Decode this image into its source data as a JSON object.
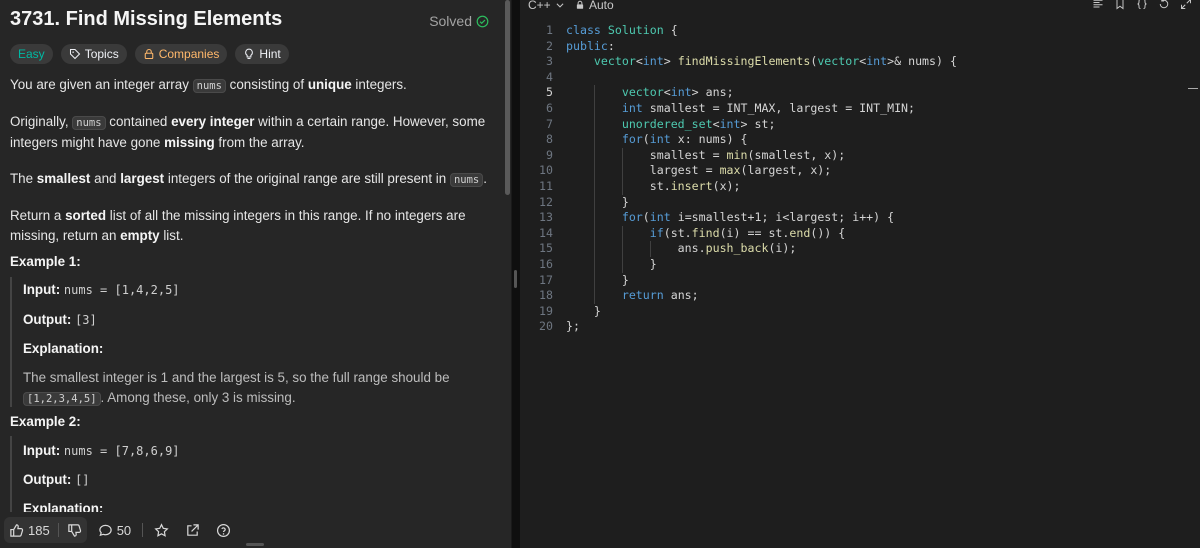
{
  "problem": {
    "title": "3731. Find Missing Elements",
    "solved_label": "Solved",
    "tags": {
      "difficulty": "Easy",
      "topics": "Topics",
      "companies": "Companies",
      "hint": "Hint"
    },
    "description": {
      "p1": [
        "You are given an integer array ",
        "nums",
        " consisting of ",
        "unique",
        " integers."
      ],
      "p2": [
        "Originally, ",
        "nums",
        " contained ",
        "every integer",
        " within a certain range. However, some integers might have gone ",
        "missing",
        " from the array."
      ],
      "p3": [
        "The ",
        "smallest",
        " and ",
        "largest",
        " integers of the original range are still present in ",
        "nums",
        "."
      ],
      "p4": [
        "Return a ",
        "sorted",
        " list of all the missing integers in this range. If no integers are missing, return an ",
        "empty",
        " list."
      ]
    },
    "examples": [
      {
        "title": "Example 1:",
        "input_label": "Input:",
        "input_value": "nums = [1,4,2,5]",
        "output_label": "Output:",
        "output_value": "[3]",
        "explanation_label": "Explanation:",
        "explanation_pre": "The smallest integer is 1 and the largest is 5, so the full range should be ",
        "explanation_code": "[1,2,3,4,5]",
        "explanation_post": ". Among these, only 3 is missing."
      },
      {
        "title": "Example 2:",
        "input_label": "Input:",
        "input_value": "nums = [7,8,6,9]",
        "output_label": "Output:",
        "output_value": "[]",
        "explanation_label": "Explanation:"
      }
    ]
  },
  "bottom_bar": {
    "likes": "185",
    "comments": "50"
  },
  "editor": {
    "language": "C++",
    "mode": "Auto",
    "active_line": 5,
    "lines": [
      "class Solution {",
      "public:",
      "    vector<int> findMissingElements(vector<int>& nums) {",
      "",
      "        vector<int> ans;",
      "        int smallest = INT_MAX, largest = INT_MIN;",
      "        unordered_set<int> st;",
      "        for(int x: nums) {",
      "            smallest = min(smallest, x);",
      "            largest = max(largest, x);",
      "            st.insert(x);",
      "        }",
      "        for(int i=smallest+1; i<largest; i++) {",
      "            if(st.find(i) == st.end()) {",
      "                ans.push_back(i);",
      "            }",
      "        }",
      "        return ans;",
      "    }",
      "};"
    ]
  },
  "colors": {
    "easy": "#00b8a3",
    "companies": "#ffb86b",
    "solved": "#2cbb5d",
    "keyword": "#569cd6",
    "type": "#4ec9b0",
    "function": "#dcdcaa"
  }
}
